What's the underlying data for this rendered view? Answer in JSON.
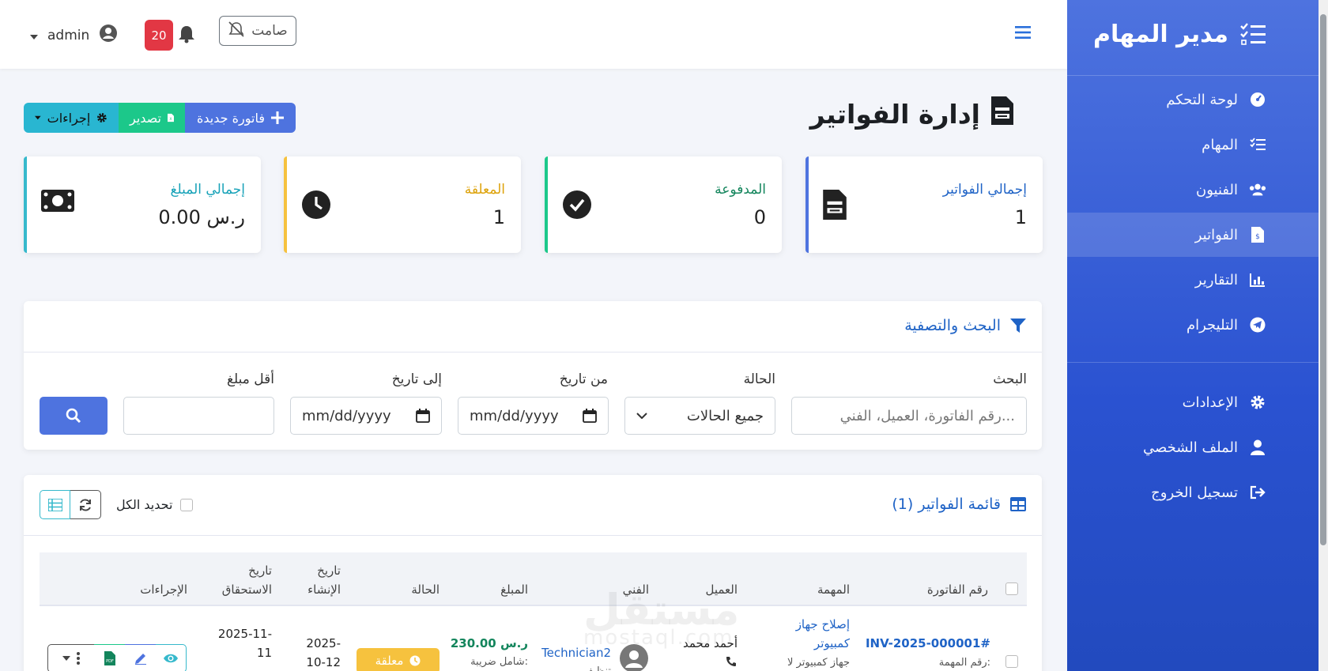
{
  "sidebar": {
    "brand": "مدير المهام",
    "items": [
      {
        "label": "لوحة التحكم",
        "icon": "dashboard-icon"
      },
      {
        "label": "المهام",
        "icon": "tasks-icon"
      },
      {
        "label": "الفنيون",
        "icon": "users-icon"
      },
      {
        "label": "الفواتير",
        "icon": "invoice-icon",
        "active": true
      },
      {
        "label": "التقارير",
        "icon": "chart-icon"
      },
      {
        "label": "التليجرام",
        "icon": "telegram-icon"
      },
      {
        "label": "الإعدادات",
        "icon": "gear-icon"
      },
      {
        "label": "الملف الشخصي",
        "icon": "user-icon"
      },
      {
        "label": "تسجيل الخروج",
        "icon": "logout-icon"
      }
    ]
  },
  "topbar": {
    "silent_label": "صامت",
    "notification_count": "20",
    "user_name": "admin"
  },
  "page": {
    "title": "إدارة الفواتير",
    "new_invoice_label": "فاتورة جديدة",
    "export_label": "تصدير",
    "actions_label": "إجراءات"
  },
  "stats": [
    {
      "label": "إجمالي الفواتير",
      "value": "1",
      "color": "#1f63c6"
    },
    {
      "label": "المدفوعة",
      "value": "0",
      "color": "#13855c"
    },
    {
      "label": "المعلقة",
      "value": "1",
      "color": "#dda20a"
    },
    {
      "label": "إجمالي المبلغ",
      "value": "0.00 ر.س",
      "color": "#17a2b8"
    }
  ],
  "filters": {
    "title": "البحث والتصفية",
    "search_label": "البحث",
    "search_placeholder": "رقم الفاتورة، العميل، الفني...",
    "status_label": "الحالة",
    "status_value": "جميع الحالات",
    "from_label": "من تاريخ",
    "to_label": "إلى تاريخ",
    "date_placeholder": "mm/dd/yyyy",
    "min_amount_label": "أقل مبلغ"
  },
  "table": {
    "title": "قائمة الفواتير (1)",
    "select_all_label": "تحديد الكل",
    "headers": {
      "invoice_no": "رقم الفاتورة",
      "task": "المهمة",
      "client": "العميل",
      "tech": "الفني",
      "amount": "المبلغ",
      "status": "الحالة",
      "created": "تاريخ الإنشاء",
      "due": "تاريخ الاستحقاق",
      "actions": "الإجراءات"
    },
    "row": {
      "invoice_no": "INV-2025-000001#",
      "task_no_label": "رقم المهمة:",
      "task_title": "إصلاح جهاز كمبيوتر",
      "task_desc": "جهاز كمبيوتر لا",
      "client": "أحمد محمد",
      "tech": "Technician2",
      "tech_sub": "تنظيف",
      "amount": "230.00 ر.س",
      "amount_note": "شامل ضريبة:",
      "status": "معلقة",
      "created": "2025-10-12",
      "due": "2025-11-11"
    }
  },
  "watermark": {
    "main": "مستقل",
    "sub": "mostaql.com"
  }
}
